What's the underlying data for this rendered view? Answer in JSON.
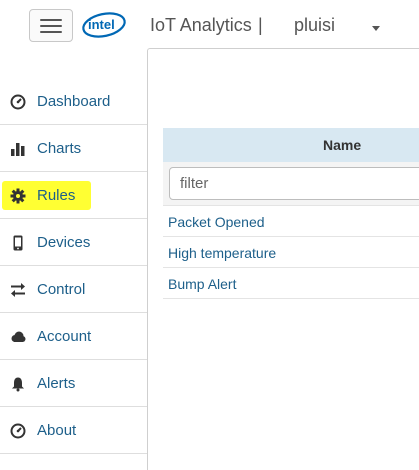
{
  "header": {
    "logo_text": "intel",
    "app_title": "IoT Analytics",
    "separator": "|",
    "account_name": "pluisi"
  },
  "sidebar": {
    "items": [
      {
        "label": "Dashboard",
        "icon": "dashboard-gauge-icon"
      },
      {
        "label": "Charts",
        "icon": "bar-chart-icon"
      },
      {
        "label": "Rules",
        "icon": "gear-icon",
        "highlighted": true
      },
      {
        "label": "Devices",
        "icon": "mobile-device-icon"
      },
      {
        "label": "Control",
        "icon": "swap-arrows-icon"
      },
      {
        "label": "Account",
        "icon": "cloud-icon"
      },
      {
        "label": "Alerts",
        "icon": "bell-icon"
      },
      {
        "label": "About",
        "icon": "info-gauge-icon"
      }
    ]
  },
  "rules_table": {
    "column_header": "Name",
    "filter_placeholder": "filter",
    "rows": [
      "Packet Opened",
      "High temperature",
      "Bump Alert"
    ]
  },
  "colors": {
    "link": "#1d5f8a",
    "highlight": "#ffff33",
    "table_header_bg": "#d8e8f2",
    "intel_blue": "#0068b5"
  }
}
